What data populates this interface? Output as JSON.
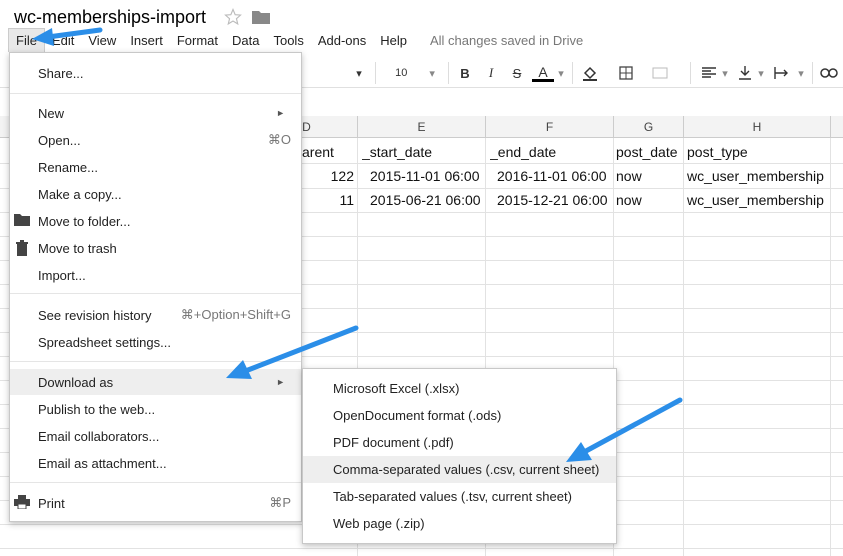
{
  "doc": {
    "title": "wc-memberships-import",
    "saved_status": "All changes saved in Drive"
  },
  "menubar": [
    "File",
    "Edit",
    "View",
    "Insert",
    "Format",
    "Data",
    "Tools",
    "Add-ons",
    "Help"
  ],
  "toolbar": {
    "font_size": "10"
  },
  "columns": [
    "D",
    "E",
    "F",
    "G",
    "H"
  ],
  "rows": [
    [
      "arent",
      "_start_date",
      "_end_date",
      "post_date",
      "post_type"
    ],
    [
      "122",
      "2015-11-01 06:00",
      "2016-11-01 06:00",
      "now",
      "wc_user_membership"
    ],
    [
      "11",
      "2015-06-21 06:00",
      "2015-12-21 06:00",
      "now",
      "wc_user_membership"
    ]
  ],
  "file_menu": {
    "share": "Share...",
    "new": "New",
    "open": "Open...",
    "open_shortcut": "⌘O",
    "rename": "Rename...",
    "make_copy": "Make a copy...",
    "move_folder": "Move to folder...",
    "move_trash": "Move to trash",
    "import": "Import...",
    "revision": "See revision history",
    "revision_shortcut": "⌘+Option+Shift+G",
    "settings": "Spreadsheet settings...",
    "download": "Download as",
    "publish": "Publish to the web...",
    "email_collab": "Email collaborators...",
    "email_attach": "Email as attachment...",
    "print": "Print",
    "print_shortcut": "⌘P"
  },
  "download_submenu": {
    "xlsx": "Microsoft Excel (.xlsx)",
    "ods": "OpenDocument format (.ods)",
    "pdf": "PDF document (.pdf)",
    "csv": "Comma-separated values (.csv, current sheet)",
    "tsv": "Tab-separated values (.tsv, current sheet)",
    "zip": "Web page (.zip)"
  },
  "colors": {
    "arrow": "#2b8ee8",
    "highlight": "#eeeeee"
  }
}
